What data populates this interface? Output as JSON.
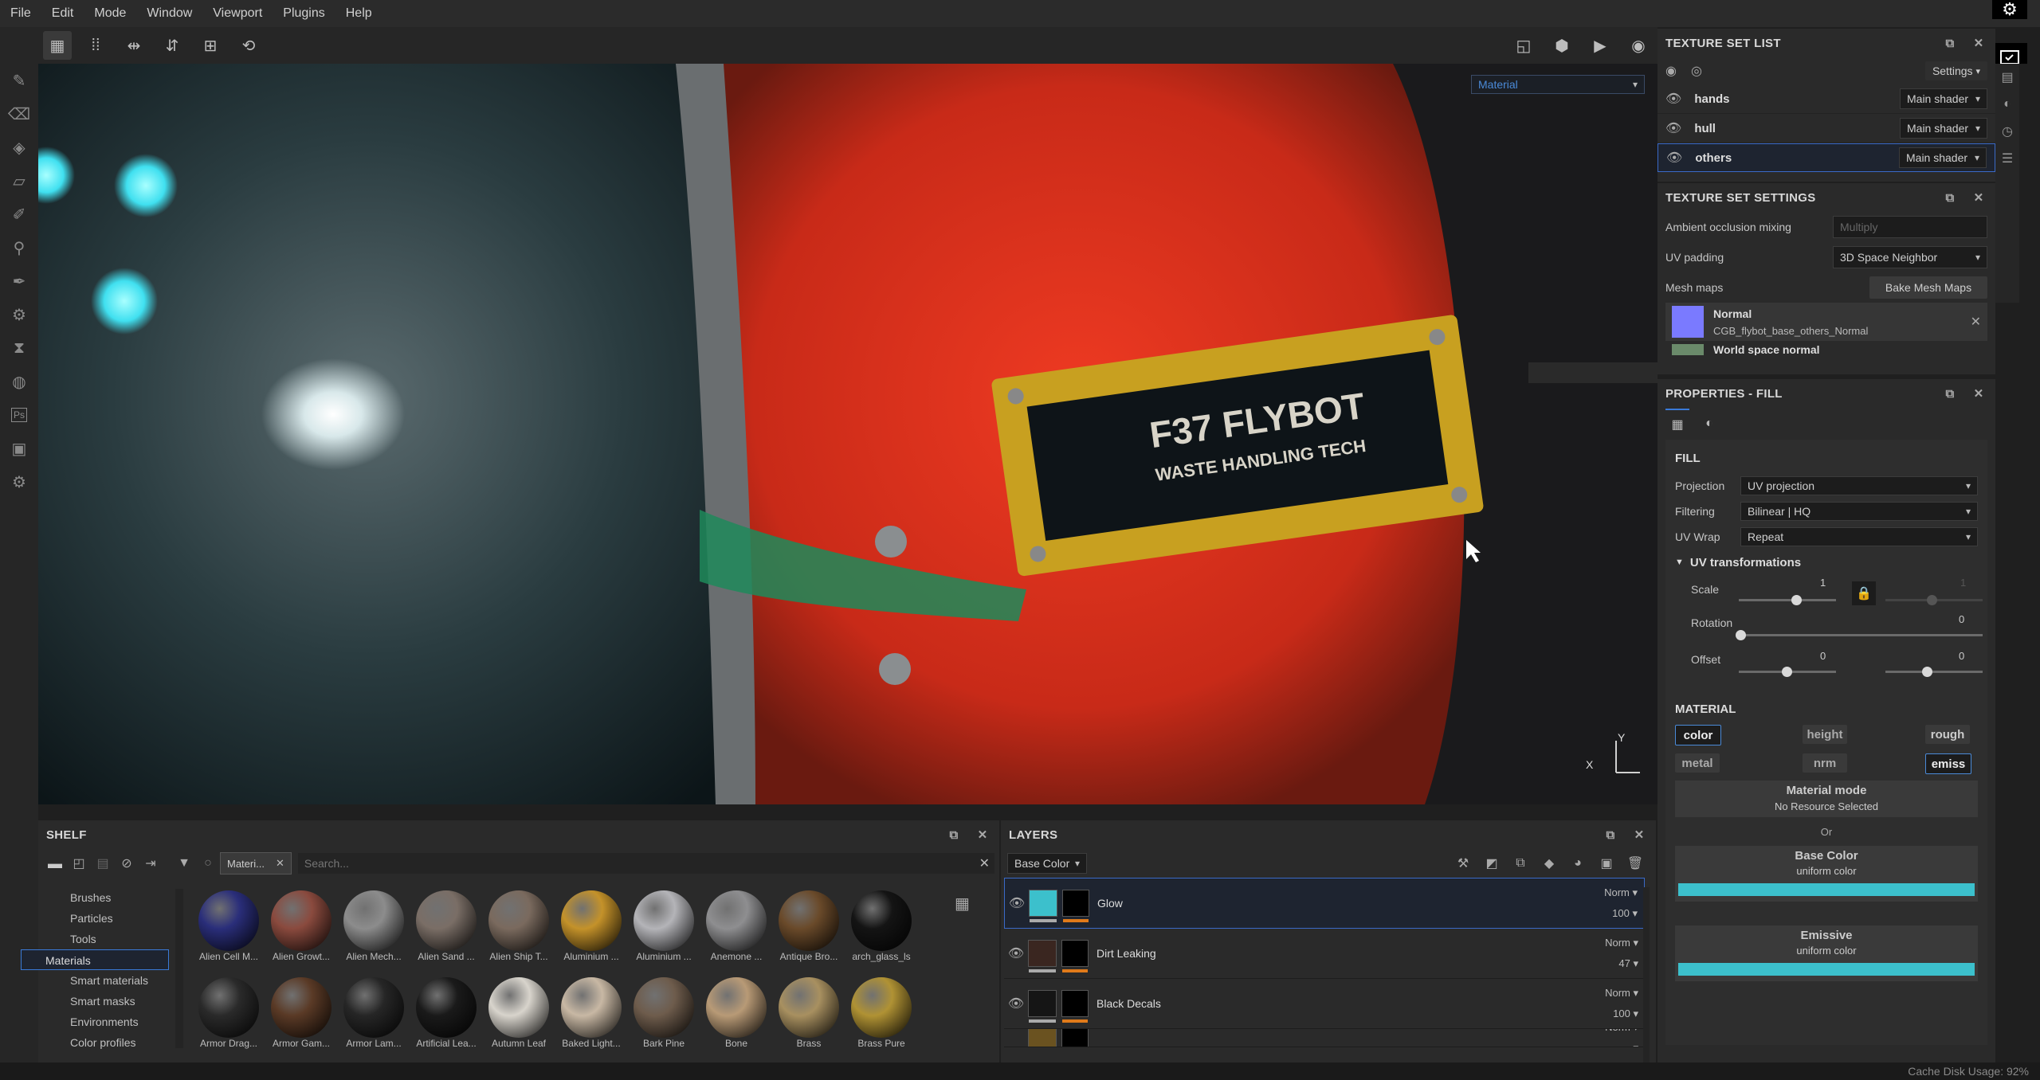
{
  "menu": [
    "File",
    "Edit",
    "Mode",
    "Window",
    "Viewport",
    "Plugins",
    "Help"
  ],
  "viewport": {
    "channel_select": "Material",
    "plate_line1": "F37 FLYBOT",
    "plate_line2": "WASTE HANDLING TECH",
    "axis_y": "Y",
    "axis_x": "X"
  },
  "texture_set_list": {
    "title": "TEXTURE SET LIST",
    "settings_label": "Settings",
    "items": [
      {
        "name": "hands",
        "shader": "Main shader"
      },
      {
        "name": "hull",
        "shader": "Main shader"
      },
      {
        "name": "others",
        "shader": "Main shader"
      }
    ]
  },
  "texture_set_settings": {
    "title": "TEXTURE SET SETTINGS",
    "ao_label": "Ambient occlusion mixing",
    "ao_value": "Multiply",
    "uv_padding_label": "UV padding",
    "uv_padding_value": "3D Space Neighbor",
    "mesh_maps_label": "Mesh maps",
    "bake_button": "Bake Mesh Maps",
    "maps": [
      {
        "name": "Normal",
        "file": "CGB_flybot_base_others_Normal"
      },
      {
        "name": "World space normal",
        "file": ""
      }
    ]
  },
  "properties": {
    "title": "PROPERTIES - FILL",
    "fill_heading": "FILL",
    "projection_label": "Projection",
    "projection_value": "UV projection",
    "filtering_label": "Filtering",
    "filtering_value": "Bilinear | HQ",
    "uvwrap_label": "UV Wrap",
    "uvwrap_value": "Repeat",
    "uvtrans_label": "UV transformations",
    "scale_label": "Scale",
    "scale_value": "1",
    "scale_value2": "1",
    "rotation_label": "Rotation",
    "rotation_value": "0",
    "offset_label": "Offset",
    "offset_value": "0",
    "offset_value2": "0",
    "material_heading": "MATERIAL",
    "channels": [
      "color",
      "height",
      "rough",
      "metal",
      "nrm",
      "emiss"
    ],
    "material_mode_label": "Material mode",
    "material_mode_value": "No Resource Selected",
    "or_label": "Or",
    "base_color_label": "Base Color",
    "base_color_sub": "uniform color",
    "emissive_label": "Emissive",
    "emissive_sub": "uniform color",
    "base_color_hex": "#3cc0cc",
    "emissive_hex": "#3cc0cc"
  },
  "shelf": {
    "title": "SHELF",
    "filter_tag": "Materi...",
    "search_placeholder": "Search...",
    "categories": [
      "Brushes",
      "Particles",
      "Tools",
      "Materials",
      "Smart materials",
      "Smart masks",
      "Environments",
      "Color profiles"
    ],
    "selected_category": "Materials",
    "materials": [
      {
        "name": "Alien Cell M...",
        "color": "#2a2e7a"
      },
      {
        "name": "Alien Growt...",
        "color": "#8a4a3e"
      },
      {
        "name": "Alien Mech...",
        "color": "#8c8c8c"
      },
      {
        "name": "Alien Sand ...",
        "color": "#7a6e66"
      },
      {
        "name": "Alien Ship T...",
        "color": "#7a6a5e"
      },
      {
        "name": "Aluminium ...",
        "color": "#c4922a"
      },
      {
        "name": "Aluminium ...",
        "color": "#b4b4b8"
      },
      {
        "name": "Anemone ...",
        "color": "#8e8e90"
      },
      {
        "name": "Antique Bro...",
        "color": "#6a4a2a"
      },
      {
        "name": "arch_glass_ls",
        "color": "#141414"
      },
      {
        "name": "Armor Drag...",
        "color": "#2a2a2a"
      },
      {
        "name": "Armor Gam...",
        "color": "#5a3a26"
      },
      {
        "name": "Armor Lam...",
        "color": "#262626"
      },
      {
        "name": "Artificial Lea...",
        "color": "#1a1a1a"
      },
      {
        "name": "Autumn Leaf",
        "color": "#d8d4cc"
      },
      {
        "name": "Baked Light...",
        "color": "#c8b8a4"
      },
      {
        "name": "Bark Pine",
        "color": "#6e5c4c"
      },
      {
        "name": "Bone",
        "color": "#b89a76"
      },
      {
        "name": "Brass",
        "color": "#a89060"
      },
      {
        "name": "Brass Pure",
        "color": "#b09234"
      }
    ]
  },
  "layers": {
    "title": "LAYERS",
    "channel_select": "Base Color",
    "items": [
      {
        "name": "Glow",
        "blend": "Norm",
        "opacity": "100",
        "thumb": "#3cc0cc"
      },
      {
        "name": "Dirt Leaking",
        "blend": "Norm",
        "opacity": "47",
        "thumb": "#3a2620"
      },
      {
        "name": "Black Decals",
        "blend": "Norm",
        "opacity": "100",
        "thumb": "#151515"
      },
      {
        "name": "",
        "blend": "Norm",
        "opacity": "",
        "thumb": "#6a5220"
      }
    ]
  },
  "status": {
    "cache_label": "Cache Disk Usage:",
    "cache_value": "92%"
  }
}
